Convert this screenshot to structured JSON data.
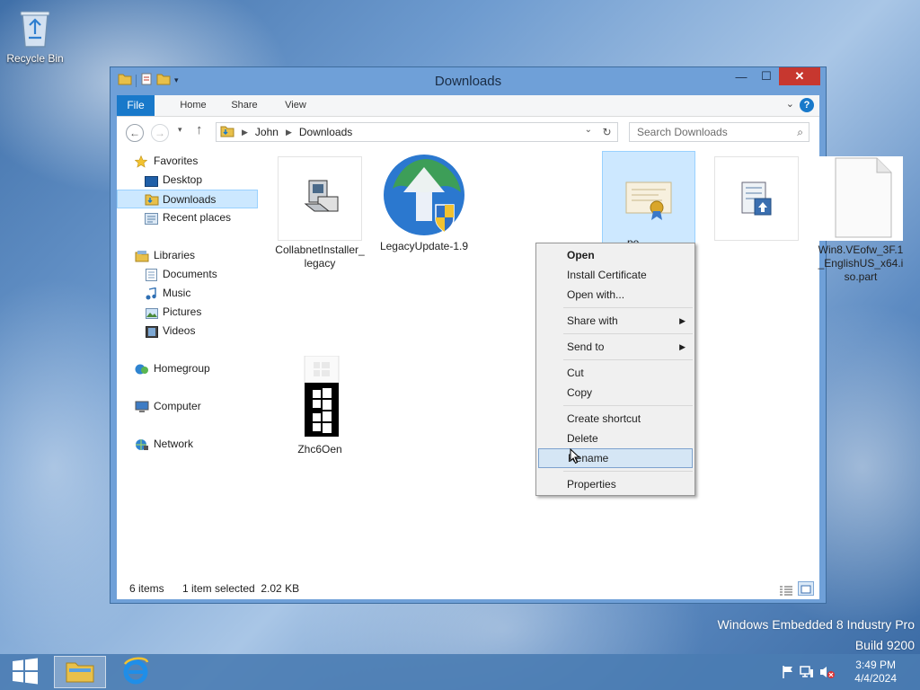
{
  "desktop": {
    "recycle_bin_label": "Recycle Bin"
  },
  "window": {
    "title": "Downloads",
    "ribbon_tabs": [
      "File",
      "Home",
      "Share",
      "View"
    ],
    "help_label": "?"
  },
  "navbar": {
    "breadcrumb": [
      "John",
      "Downloads"
    ],
    "search_placeholder": "Search Downloads"
  },
  "navpane": {
    "favorites": "Favorites",
    "desktop": "Desktop",
    "downloads": "Downloads",
    "recent_places": "Recent places",
    "libraries": "Libraries",
    "documents": "Documents",
    "music": "Music",
    "pictures": "Pictures",
    "videos": "Videos",
    "homegroup": "Homegroup",
    "computer": "Computer",
    "network": "Network"
  },
  "files": [
    {
      "name": "CollabnetInstaller_legacy",
      "icon": "installer-icon"
    },
    {
      "name": "LegacyUpdate-1.9",
      "icon": "legacy-update-icon"
    },
    {
      "name": "pe",
      "icon": "certificate-icon"
    },
    {
      "name": "",
      "icon": "setup-file-icon"
    },
    {
      "name": "Win8.VEofw_3F.1_EnglishUS_x64.iso.part",
      "icon": "blank-file-icon"
    },
    {
      "name": "Zhc6Oen",
      "icon": "windows-logo-icon"
    }
  ],
  "statusbar": {
    "item_count": "6 items",
    "selection": "1 item selected  2.02 KB"
  },
  "context_menu": {
    "open": "Open",
    "install_certificate": "Install Certificate",
    "open_with": "Open with...",
    "share_with": "Share with",
    "send_to": "Send to",
    "cut": "Cut",
    "copy": "Copy",
    "create_shortcut": "Create shortcut",
    "delete": "Delete",
    "rename": "Rename",
    "properties": "Properties"
  },
  "watermark": {
    "line1": "Windows Embedded 8 Industry Pro",
    "line2": "Build 9200"
  },
  "taskbar": {
    "time": "3:49 PM",
    "date": "4/4/2024"
  },
  "colors": {
    "accent": "#1979ca",
    "close": "#c7372f",
    "selection": "#cce8ff"
  }
}
